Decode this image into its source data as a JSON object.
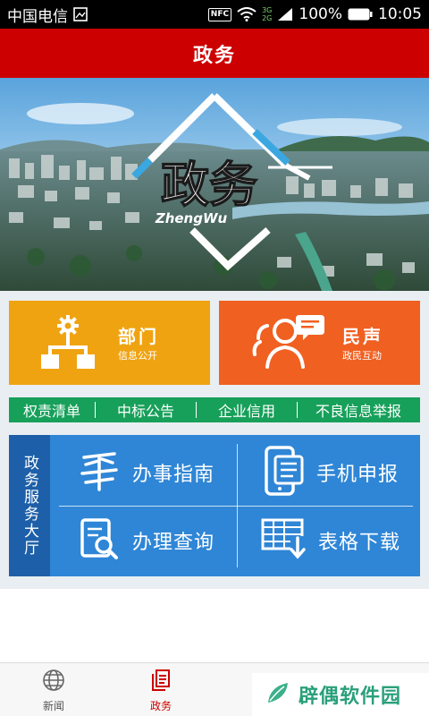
{
  "status_bar": {
    "carrier": "中国电信",
    "nfc": "NFC",
    "net_3g": "3G",
    "net_2g": "2G",
    "battery": "100%",
    "time": "10:05"
  },
  "header": {
    "title": "政务"
  },
  "banner": {
    "title": "政务",
    "subtitle": "ZhengWu"
  },
  "cards": {
    "department": {
      "title": "部门",
      "subtitle": "信息公开",
      "icon": "org-chart-gear-icon",
      "color": "#f0a311"
    },
    "public_voice": {
      "title": "民声",
      "subtitle": "政民互动",
      "icon": "people-chat-icon",
      "color": "#f06021"
    }
  },
  "quick_links": [
    "权责清单",
    "中标公告",
    "企业信用",
    "不良信息举报"
  ],
  "service_hall": {
    "label": "政务服务大厅",
    "items": [
      {
        "label": "办事指南",
        "icon": "guide-icon"
      },
      {
        "label": "手机申报",
        "icon": "mobile-form-icon"
      },
      {
        "label": "办理查询",
        "icon": "search-document-icon"
      },
      {
        "label": "表格下载",
        "icon": "table-download-icon"
      }
    ]
  },
  "bottom_nav": {
    "items": [
      {
        "label": "新闻",
        "icon": "globe-icon",
        "active": false
      },
      {
        "label": "政务",
        "icon": "document-stack-icon",
        "active": true
      }
    ]
  },
  "watermark": {
    "text": "辟偶软件园"
  },
  "colors": {
    "primary": "#cc0000",
    "green": "#17a05a",
    "blue": "#2f86d6",
    "dark_blue": "#1d5fa8"
  }
}
